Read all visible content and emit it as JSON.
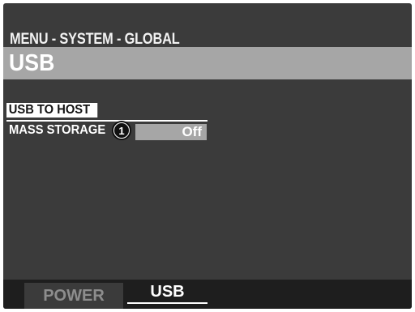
{
  "menu": {
    "breadcrumb": "MENU - SYSTEM - GLOBAL",
    "title": "USB"
  },
  "settings": [
    {
      "label": "USB TO HOST",
      "value": "",
      "selected": true
    },
    {
      "label": "MASS STORAGE",
      "value": "Off",
      "selected": false
    }
  ],
  "callout": {
    "number": "1"
  },
  "tabs": [
    {
      "label": "POWER",
      "active": false
    },
    {
      "label": "USB",
      "active": true
    }
  ],
  "colors": {
    "screen": "#3b3b3b",
    "title_bar": "#a6a6a6",
    "tabbar": "#1e1e1e"
  }
}
